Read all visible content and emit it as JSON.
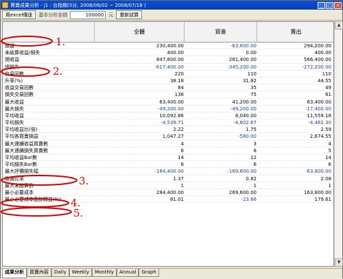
{
  "window": {
    "title": "賈賣成果分析 - j1 : 台指期(5分, 2008/06/02 ~ 2008/07/18 )"
  },
  "toolbar": {
    "export_label": "用excel傳送",
    "amount_label": "基本分析金額",
    "amount_value": "100000",
    "currency": "元",
    "recalc_label": "重新試算"
  },
  "table": {
    "columns": [
      "",
      "全體",
      "買進",
      "賣出"
    ],
    "rows": [
      {
        "label": "損益",
        "all": "230,400.00",
        "buy": "-63,800.00",
        "sell": "294,200.00"
      },
      {
        "label": "未結算收益/損失",
        "all": "400.00",
        "buy": "0.00",
        "sell": "400.00"
      },
      {
        "label": "總收益",
        "all": "847,800.00",
        "buy": "281,400.00",
        "sell": "566,400.00"
      },
      {
        "label": "總損失",
        "all": "-617,400.00",
        "buy": "-345,200.00",
        "sell": "-272,200.00"
      },
      {
        "label": "交易回數",
        "all": "220",
        "buy": "110",
        "sell": "110"
      },
      {
        "label": "升率(%)",
        "all": "38.18",
        "buy": "31.82",
        "sell": "44.55"
      },
      {
        "label": "收益交易回數",
        "all": "84",
        "buy": "35",
        "sell": "49"
      },
      {
        "label": "損失交易回數",
        "all": "136",
        "buy": "75",
        "sell": "61"
      },
      {
        "label": "最大收益",
        "all": "63,400.00",
        "buy": "41,200.00",
        "sell": "63,400.00"
      },
      {
        "label": "最大損失",
        "all": "-49,200.00",
        "buy": "-49,200.00",
        "sell": "-17,400.00"
      },
      {
        "label": "平均收益",
        "all": "10,092.86",
        "buy": "8,040.00",
        "sell": "11,559.18"
      },
      {
        "label": "平均損失",
        "all": "-4,539.71",
        "buy": "-4,602.67",
        "sell": "-4,462.30"
      },
      {
        "label": "平均收益比(倍)",
        "all": "2.22",
        "buy": "1.75",
        "sell": "2.59"
      },
      {
        "label": "平均各買賣損益",
        "all": "1,047.27",
        "buy": "-580.00",
        "sell": "2,674.55"
      },
      {
        "label": "最大連續收益買賣數",
        "all": "4",
        "buy": "3",
        "sell": "4"
      },
      {
        "label": "最大連續損失買賣數",
        "all": "6",
        "buy": "8",
        "sell": "5"
      },
      {
        "label": "平均收益Bar數",
        "all": "14",
        "buy": "12",
        "sell": "14"
      },
      {
        "label": "平均損失Bar數",
        "all": "6",
        "buy": "6",
        "sell": "6"
      },
      {
        "label": "最大評價損失幅",
        "all": "-184,400.00",
        "buy": "-169,600.00",
        "sell": "-63,800.00"
      },
      {
        "label": "賠償比率",
        "all": "1.37",
        "buy": "0.82",
        "sell": "2.08"
      },
      {
        "label": "最大未結算數",
        "all": "1",
        "buy": "1",
        "sell": "1"
      },
      {
        "label": "最小必要成本",
        "all": "284,400.00",
        "buy": "269,600.00",
        "sell": "163,800.00"
      },
      {
        "label": "最小必要成本盈餘轉益(%)",
        "all": "81.01",
        "buy": "-23.66",
        "sell": "179.61"
      }
    ]
  },
  "annotations": [
    "1.",
    "2.",
    "3.",
    "4.",
    "5."
  ],
  "tabs": [
    "成果分析",
    "買賣內容",
    "Daily",
    "Weekly",
    "Monthly",
    "Annual",
    "Graph"
  ],
  "colors": {
    "annotation": "#d40000",
    "negative": "#1c3f9c",
    "titlebar": "#0a4fd4"
  }
}
